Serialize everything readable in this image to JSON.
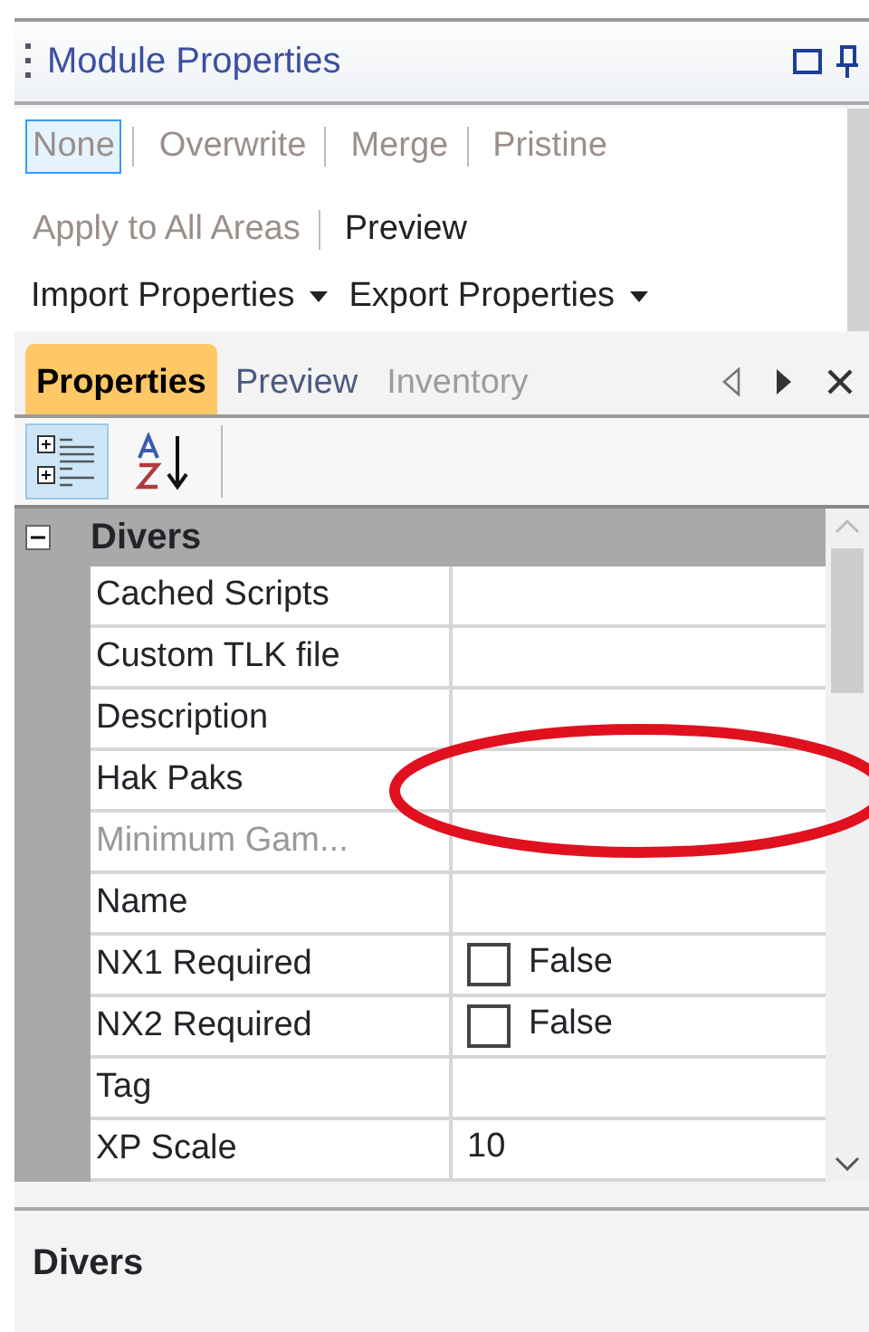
{
  "panel": {
    "title": "Module Properties"
  },
  "toolbar": {
    "items": [
      {
        "label": "None",
        "selected": true,
        "disabled": true
      },
      {
        "label": "Overwrite",
        "selected": false,
        "disabled": true
      },
      {
        "label": "Merge",
        "selected": false,
        "disabled": true
      },
      {
        "label": "Pristine",
        "selected": false,
        "disabled": true
      },
      {
        "label": "Apply to All Areas",
        "selected": false,
        "disabled": true
      },
      {
        "label": "Preview",
        "selected": false,
        "disabled": false
      }
    ],
    "menus": [
      {
        "label": "Import Properties"
      },
      {
        "label": "Export Properties"
      }
    ]
  },
  "tabs": [
    {
      "label": "Properties",
      "selected": true,
      "disabled": false
    },
    {
      "label": "Preview",
      "selected": false,
      "disabled": false
    },
    {
      "label": "Inventory",
      "selected": false,
      "disabled": true
    }
  ],
  "grid": {
    "category": {
      "label": "Divers",
      "expanded": true
    },
    "rows": [
      {
        "name": "Cached Scripts",
        "kind": "text",
        "disabled": false
      },
      {
        "name": "Custom TLK file",
        "kind": "text",
        "disabled": false
      },
      {
        "name": "Description",
        "kind": "text",
        "disabled": false
      },
      {
        "name": "Hak Paks",
        "kind": "text",
        "disabled": false
      },
      {
        "name": "Minimum Gam...",
        "kind": "text",
        "disabled": true
      },
      {
        "name": "Name",
        "kind": "text",
        "disabled": false
      },
      {
        "name": "NX1 Required",
        "kind": "checkbox",
        "checked": false,
        "value": "False",
        "disabled": false
      },
      {
        "name": "NX2 Required",
        "kind": "checkbox",
        "checked": false,
        "value": "False",
        "disabled": false
      },
      {
        "name": "Tag",
        "kind": "text",
        "disabled": false
      },
      {
        "name": "XP Scale",
        "kind": "text",
        "value": "10",
        "disabled": false
      }
    ]
  },
  "annotations": [
    {
      "kind": "ellipse"
    }
  ],
  "description": {
    "title": "Divers"
  }
}
